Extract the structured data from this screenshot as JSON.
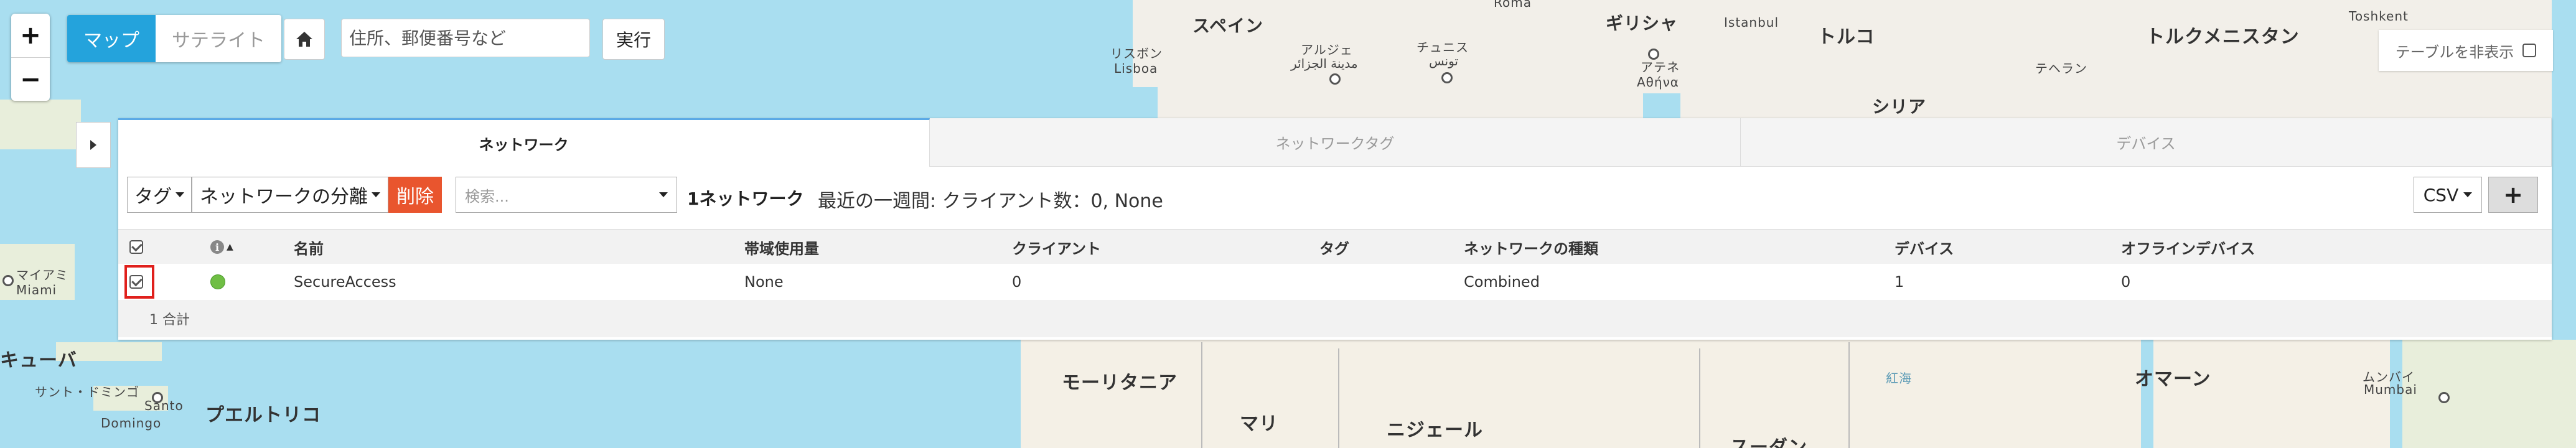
{
  "map": {
    "zoom_in": "+",
    "zoom_out": "−",
    "type_map": "マップ",
    "type_satellite": "サテライト",
    "search_placeholder": "住所、郵便番号など",
    "search_value": "",
    "exec": "実行",
    "labels": {
      "spain": "スペイン",
      "lisbon_ja": "リスボン",
      "lisbon": "Lisboa",
      "algiers_ja": "アルジェ",
      "algiers_ar": "مدينة الجزائر",
      "tunis_ja": "チュニス",
      "tunis_ar": "تونس",
      "roma": "Roma",
      "greece": "ギリシャ",
      "athens_ja": "アテネ",
      "athens": "Αθήνα",
      "istanbul": "Istanbul",
      "turkey": "トルコ",
      "syria": "シリア",
      "tehran_ja": "テヘラン",
      "turkmenistan": "トルクメニスタン",
      "toshkent": "Toshkent",
      "mauritania": "モーリタニア",
      "mali": "マリ",
      "niger": "ニジェール",
      "sudan": "スーダン",
      "oman": "オマーン",
      "mumbai_ja": "ムンバイ",
      "mumbai": "Mumbai",
      "miami_ja": "マイアミ",
      "miami": "Miami",
      "cuba": "キューバ",
      "santo_domingo_ja": "サント・ドミンゴ",
      "santo": "Santo",
      "domingo": "Domingo",
      "puerto_rico": "プエルトリコ",
      "red_sea": "紅海"
    }
  },
  "hide_table_label": "テーブルを非表示",
  "tabs": [
    {
      "label": "ネットワーク",
      "active": true
    },
    {
      "label": "ネットワークタグ",
      "active": false
    },
    {
      "label": "デバイス",
      "active": false
    }
  ],
  "toolbar": {
    "tag": "タグ",
    "split": "ネットワークの分離",
    "delete": "削除",
    "search_placeholder": "検索...",
    "count": "1ネットワーク",
    "summary": "最近の一週間: クライアント数：0, None",
    "csv": "CSV",
    "add": "+"
  },
  "table": {
    "columns": [
      "",
      "",
      "名前",
      "帯域使用量",
      "クライアント",
      "タグ",
      "ネットワークの種類",
      "デバイス",
      "オフラインデバイス"
    ],
    "rows": [
      {
        "checked": true,
        "status": "online",
        "name": "SecureAccess",
        "bandwidth": "None",
        "clients": "0",
        "tags": "",
        "type": "Combined",
        "devices": "1",
        "offline": "0"
      }
    ],
    "footer": "1 合計"
  },
  "colors": {
    "accent": "#24a3dc",
    "delete": "#e9552e",
    "status_online": "#6fbe44",
    "highlight": "#e0201c",
    "sea": "#a9def0",
    "land": "#f2efe9"
  }
}
